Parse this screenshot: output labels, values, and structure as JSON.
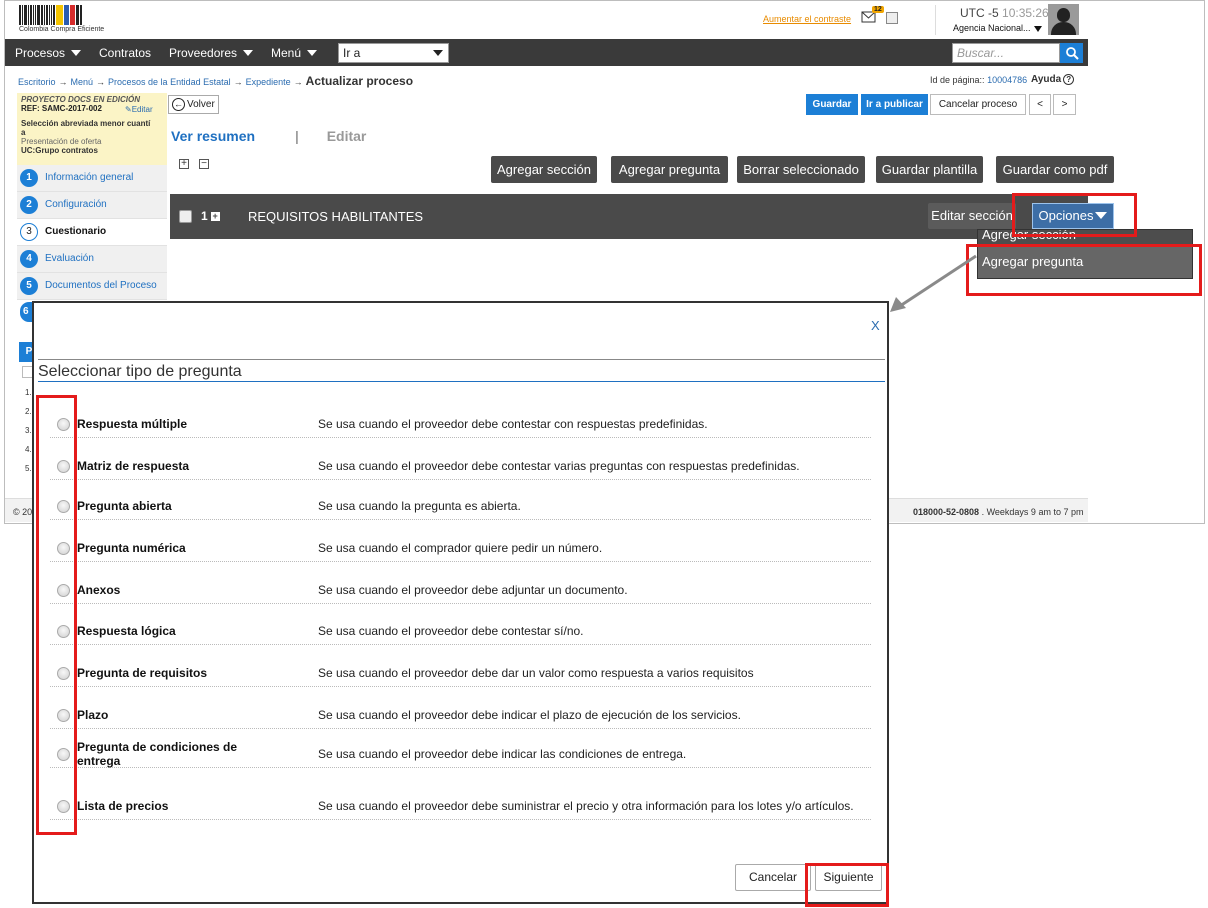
{
  "header": {
    "logo_text": "Colombia Compra Eficiente",
    "contrast_link": "Aumentar el contraste",
    "mail_badge": "12",
    "timezone": "UTC -5",
    "time": "10:35:26",
    "agency": "Agencia Nacional..."
  },
  "nav": {
    "items": [
      "Procesos",
      "Contratos",
      "Proveedores",
      "Menú"
    ],
    "ira_label": "Ir a",
    "search_placeholder": "Buscar..."
  },
  "breadcrumb": {
    "items": [
      "Escritorio",
      "Menú",
      "Procesos de la Entidad Estatal",
      "Expediente"
    ],
    "current": "Actualizar proceso",
    "page_id_label": "Id de página::",
    "page_id": "10004786",
    "help": "Ayuda"
  },
  "process": {
    "status": "PROYECTO DOCS EN EDICIÓN",
    "ref": "REF: SAMC-2017-002",
    "edit_label": "Editar",
    "type_line1": "Selección abreviada menor cuantí",
    "type_line2": "a",
    "stage": "Presentación de oferta",
    "uc": "UC:Grupo contratos"
  },
  "steps": [
    {
      "num": "1",
      "label": "Información general"
    },
    {
      "num": "2",
      "label": "Configuración"
    },
    {
      "num": "3",
      "label": "Cuestionario"
    },
    {
      "num": "4",
      "label": "Evaluación"
    },
    {
      "num": "5",
      "label": "Documentos del Proceso"
    }
  ],
  "side_fragments": {
    "step6": "6",
    "panel_letter": "P",
    "list_nums": [
      "1.",
      "2.",
      "3.",
      "4.",
      "5."
    ]
  },
  "toolbar": {
    "volver": "Volver",
    "guardar": "Guardar",
    "publicar": "Ir a publicar",
    "cancelar_proceso": "Cancelar proceso",
    "prev": "<",
    "next": ">"
  },
  "tabs": {
    "resumen": "Ver resumen",
    "sep": "|",
    "editar": "Editar"
  },
  "actions": [
    "Agregar sección",
    "Agregar pregunta",
    "Borrar seleccionado",
    "Guardar plantilla",
    "Guardar como pdf"
  ],
  "section": {
    "number": "1",
    "title": "REQUISITOS HABILITANTES",
    "edit_label": "Editar sección",
    "options_label": "Opciones"
  },
  "dropdown": {
    "items": [
      "Agregar sección",
      "Agregar pregunta"
    ]
  },
  "footer": {
    "copy": "© 20",
    "phone": "018000-52-0808",
    "hours": ". Weekdays 9 am to 7 pm"
  },
  "modal": {
    "close": "X",
    "title": "Seleccionar tipo de pregunta",
    "questions": [
      {
        "name": "Respuesta múltiple",
        "desc": "Se usa cuando el proveedor debe contestar con respuestas predefinidas."
      },
      {
        "name": "Matriz de respuesta",
        "desc": "Se usa cuando el proveedor debe contestar varias preguntas con respuestas predefinidas."
      },
      {
        "name": "Pregunta abierta",
        "desc": "Se usa cuando la pregunta es abierta."
      },
      {
        "name": "Pregunta numérica",
        "desc": "Se usa cuando el comprador quiere pedir un número."
      },
      {
        "name": "Anexos",
        "desc": "Se usa cuando el proveedor debe adjuntar un documento."
      },
      {
        "name": "Respuesta lógica",
        "desc": "Se usa cuando el proveedor debe contestar sí/no."
      },
      {
        "name": "Pregunta de requisitos",
        "desc": "Se usa cuando el proveedor debe dar un valor como respuesta a varios requisitos"
      },
      {
        "name": "Plazo",
        "desc": "Se usa cuando el proveedor debe indicar el plazo de ejecución de los servicios."
      },
      {
        "name": "Pregunta de condiciones de entrega",
        "desc": "Se usa cuando el proveedor debe indicar las condiciones de entrega."
      },
      {
        "name": "Lista de precios",
        "desc": "Se usa cuando el proveedor debe suministrar el precio y otra información para los lotes y/o artículos."
      }
    ],
    "cancel": "Cancelar",
    "next": "Siguiente"
  },
  "colors": {
    "accent": "#1c7fd6",
    "annotation": "#e41b1b",
    "nav": "#3a3a3a"
  }
}
